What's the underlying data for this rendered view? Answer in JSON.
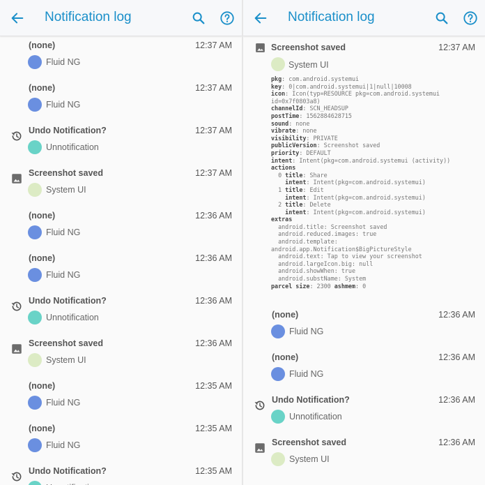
{
  "app": {
    "title": "Notification log"
  },
  "colors": {
    "accent": "#1a8fc9",
    "fluid_ng_icon": "#6a8fe0",
    "unnotification_icon": "#69d3c7",
    "system_ui_icon": "#dcebc4"
  },
  "icons": {
    "back": "arrow-back-icon",
    "search": "search-icon",
    "help": "help-circle-icon",
    "undo": "history-icon",
    "screenshot": "image-icon",
    "fluid": "fluid-ng-app-icon",
    "unnotification": "unnotification-app-icon",
    "systemui": "system-ui-app-icon"
  },
  "left_entries": [
    {
      "title": "(none)",
      "time": "12:37 AM",
      "app": "Fluid NG",
      "type": "fluid"
    },
    {
      "title": "(none)",
      "time": "12:37 AM",
      "app": "Fluid NG",
      "type": "fluid"
    },
    {
      "title": "Undo Notification?",
      "time": "12:37 AM",
      "app": "Unnotification",
      "type": "unnot"
    },
    {
      "title": "Screenshot saved",
      "time": "12:37 AM",
      "app": "System UI",
      "type": "sys"
    },
    {
      "title": "(none)",
      "time": "12:36 AM",
      "app": "Fluid NG",
      "type": "fluid"
    },
    {
      "title": "(none)",
      "time": "12:36 AM",
      "app": "Fluid NG",
      "type": "fluid"
    },
    {
      "title": "Undo Notification?",
      "time": "12:36 AM",
      "app": "Unnotification",
      "type": "unnot"
    },
    {
      "title": "Screenshot saved",
      "time": "12:36 AM",
      "app": "System UI",
      "type": "sys"
    },
    {
      "title": "(none)",
      "time": "12:35 AM",
      "app": "Fluid NG",
      "type": "fluid"
    },
    {
      "title": "(none)",
      "time": "12:35 AM",
      "app": "Fluid NG",
      "type": "fluid"
    },
    {
      "title": "Undo Notification?",
      "time": "12:35 AM",
      "app": "Unnotification",
      "type": "unnot"
    }
  ],
  "detail": {
    "title": "Screenshot saved",
    "time": "12:37 AM",
    "app": "System UI",
    "lines": [
      {
        "k": "pkg",
        "v": ": com.android.systemui",
        "ind": ""
      },
      {
        "k": "key",
        "v": ": 0|com.android.systemui|1|null|10008",
        "ind": ""
      },
      {
        "k": "icon",
        "v": ": Icon(typ=RESOURCE pkg=com.android.systemui",
        "ind": ""
      },
      {
        "k": "",
        "v": "id=0x7f0803a8)",
        "ind": ""
      },
      {
        "k": "channelId",
        "v": ": SCN_HEADSUP",
        "ind": ""
      },
      {
        "k": "postTime",
        "v": ": 1562884628715",
        "ind": ""
      },
      {
        "k": "sound",
        "v": ": none",
        "ind": ""
      },
      {
        "k": "vibrate",
        "v": ": none",
        "ind": ""
      },
      {
        "k": "visibility",
        "v": ": PRIVATE",
        "ind": ""
      },
      {
        "k": "publicVersion",
        "v": ": Screenshot saved",
        "ind": ""
      },
      {
        "k": "priority",
        "v": ": DEFAULT",
        "ind": ""
      },
      {
        "k": "intent",
        "v": ": Intent(pkg=com.android.systemui (activity))",
        "ind": ""
      },
      {
        "k": "actions",
        "v": "",
        "ind": ""
      },
      {
        "k": "title",
        "v": ": Share",
        "ind": "  0 "
      },
      {
        "k": "intent",
        "v": ": Intent(pkg=com.android.systemui)",
        "ind": "    "
      },
      {
        "k": "title",
        "v": ": Edit",
        "ind": "  1 "
      },
      {
        "k": "intent",
        "v": ": Intent(pkg=com.android.systemui)",
        "ind": "    "
      },
      {
        "k": "title",
        "v": ": Delete",
        "ind": "  2 "
      },
      {
        "k": "intent",
        "v": ": Intent(pkg=com.android.systemui)",
        "ind": "    "
      },
      {
        "k": "extras",
        "v": "",
        "ind": ""
      },
      {
        "k": "",
        "v": "android.title: Screenshot saved",
        "ind": "  "
      },
      {
        "k": "",
        "v": "android.reduced.images: true",
        "ind": "  "
      },
      {
        "k": "",
        "v": "android.template:",
        "ind": "  "
      },
      {
        "k": "",
        "v": "android.app.Notification$BigPictureStyle",
        "ind": ""
      },
      {
        "k": "",
        "v": "android.text: Tap to view your screenshot",
        "ind": "  "
      },
      {
        "k": "",
        "v": "android.largeIcon.big: null",
        "ind": "  "
      },
      {
        "k": "",
        "v": "android.showWhen: true",
        "ind": "  "
      },
      {
        "k": "",
        "v": "android.substName: System",
        "ind": "  "
      },
      {
        "k": "parcel size",
        "v": ": 2300 ",
        "ind": "",
        "k2": "ashmem",
        "v2": ": 0"
      }
    ]
  },
  "right_entries": [
    {
      "title": "(none)",
      "time": "12:36 AM",
      "app": "Fluid NG",
      "type": "fluid"
    },
    {
      "title": "(none)",
      "time": "12:36 AM",
      "app": "Fluid NG",
      "type": "fluid"
    },
    {
      "title": "Undo Notification?",
      "time": "12:36 AM",
      "app": "Unnotification",
      "type": "unnot"
    },
    {
      "title": "Screenshot saved",
      "time": "12:36 AM",
      "app": "System UI",
      "type": "sys"
    }
  ]
}
